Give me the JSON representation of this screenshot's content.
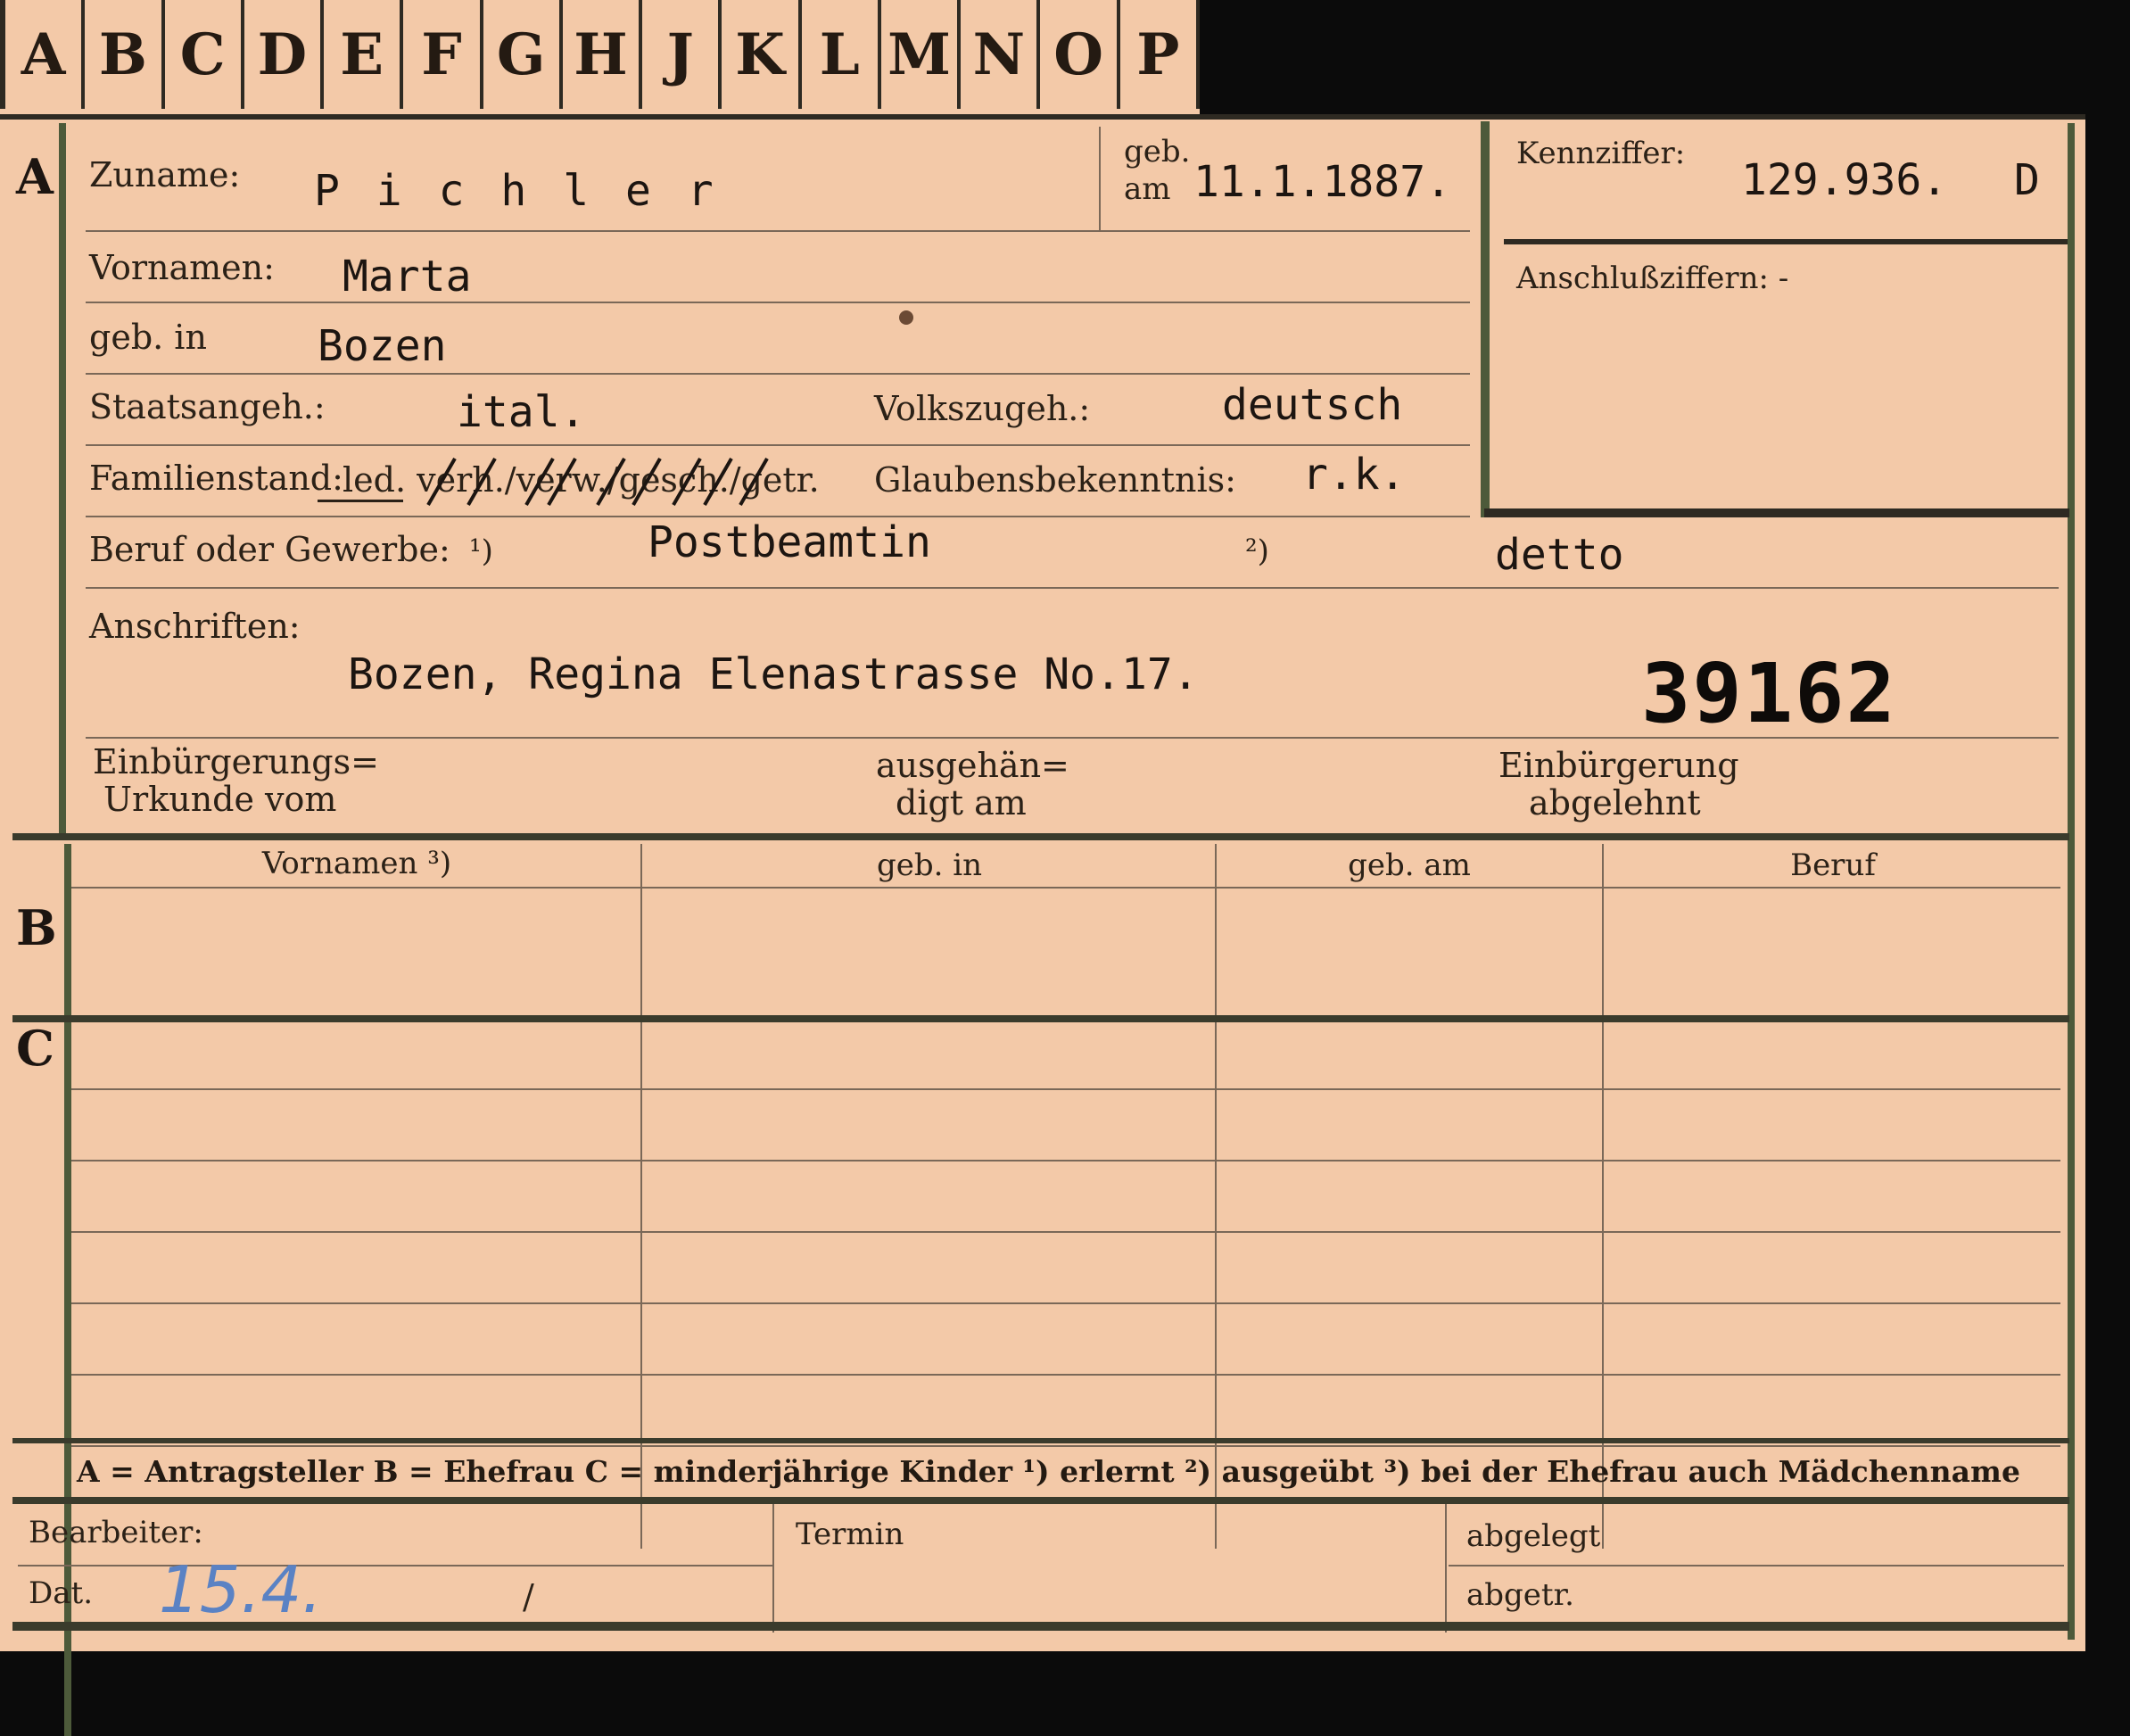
{
  "index_tabs": [
    "A",
    "B",
    "C",
    "D",
    "E",
    "F",
    "G",
    "H",
    "J",
    "K",
    "L",
    "M",
    "N",
    "O",
    "P"
  ],
  "sections": {
    "a": "A",
    "b": "B",
    "c": "C"
  },
  "section_a": {
    "surname_label": "Zuname:",
    "surname": "P i c h l e r",
    "born_on_label_1": "geb.",
    "born_on_label_2": "am",
    "born_on": "11.1.1887.",
    "given_names_label": "Vornamen:",
    "given_names": "Marta",
    "born_in_label": "geb. in",
    "born_in": "Bozen",
    "citizenship_label": "Staatsangeh.:",
    "citizenship": "ital.",
    "ethnicity_label": "Volkszugeh.:",
    "ethnicity": "deutsch",
    "marital_label": "Familienstand:",
    "marital_options": "led.  verh./verw./gesch./getr.",
    "religion_label": "Glaubensbekenntnis:",
    "religion": "r.k.",
    "occupation_label": "Beruf oder Gewerbe:",
    "occ_note_1": "¹)",
    "occ_note_2": "²)",
    "occupation_learned": "Postbeamtin",
    "occupation_practiced": "detto",
    "address_label": "Anschriften:",
    "address": "Bozen, Regina Elenastrasse No.17.",
    "naturalization_cert_label_1": "Einbürgerungs=",
    "naturalization_cert_label_2": "Urkunde vom",
    "handed_out_label_1": "ausgehän=",
    "handed_out_label_2": "digt am",
    "naturalization_refused_label_1": "Einbürgerung",
    "naturalization_refused_label_2": "abgelehnt"
  },
  "id_box": {
    "code_label": "Kennziffer:",
    "code": "129.936.",
    "code_suffix": "D",
    "linked_label": "Anschlußziffern: -"
  },
  "stamp_number": "39162",
  "table_b_headers": [
    "Vornamen ³)",
    "geb. in",
    "geb. am",
    "Beruf"
  ],
  "legend": "A = Antragsteller   B = Ehefrau   C = minderjährige Kinder   ¹) erlernt   ²) ausgeübt   ³) bei der Ehefrau auch Mädchenname",
  "footer": {
    "processor_label": "Bearbeiter:",
    "date_label": "Dat.",
    "date_value": "15.4.",
    "date_slash": "/",
    "deadline_label": "Termin",
    "filed_label": "abgelegt",
    "removed_label": "abgetr."
  }
}
